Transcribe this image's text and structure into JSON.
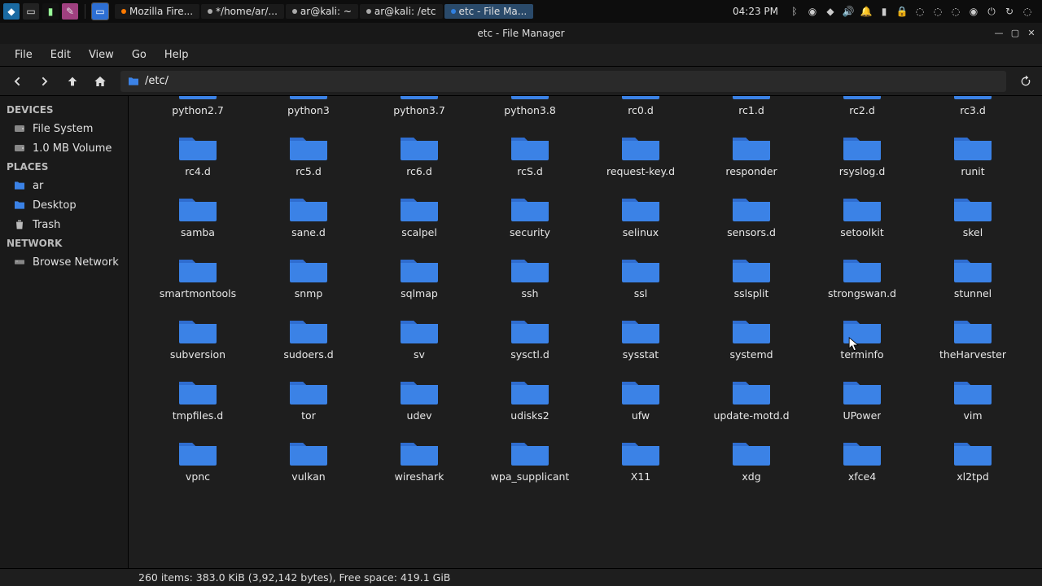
{
  "taskbar": {
    "time": "04:23 PM",
    "tasks": [
      {
        "label": "Mozilla Fire...",
        "kind": "ff"
      },
      {
        "label": "*/home/ar/...",
        "kind": "term"
      },
      {
        "label": "ar@kali: ~",
        "kind": "term"
      },
      {
        "label": "ar@kali: /etc",
        "kind": "term"
      },
      {
        "label": "etc - File Ma...",
        "kind": "fm",
        "active": true
      }
    ]
  },
  "window": {
    "title": "etc - File Manager"
  },
  "menubar": {
    "items": [
      "File",
      "Edit",
      "View",
      "Go",
      "Help"
    ]
  },
  "toolbar": {
    "path": "/etc/"
  },
  "sidebar": {
    "devices_header": "DEVICES",
    "devices": [
      {
        "label": "File System",
        "icon": "disk"
      },
      {
        "label": "1.0 MB Volume",
        "icon": "disk"
      }
    ],
    "places_header": "PLACES",
    "places": [
      {
        "label": "ar",
        "icon": "folder"
      },
      {
        "label": "Desktop",
        "icon": "folder"
      },
      {
        "label": "Trash",
        "icon": "trash"
      }
    ],
    "network_header": "NETWORK",
    "network": [
      {
        "label": "Browse Network",
        "icon": "net"
      }
    ]
  },
  "folders": {
    "row_partial": [
      "python2.7",
      "python3",
      "python3.7",
      "python3.8",
      "rc0.d",
      "rc1.d",
      "rc2.d",
      "rc3.d"
    ],
    "rows": [
      [
        "rc4.d",
        "rc5.d",
        "rc6.d",
        "rcS.d",
        "request-key.d",
        "responder",
        "rsyslog.d",
        "runit"
      ],
      [
        "samba",
        "sane.d",
        "scalpel",
        "security",
        "selinux",
        "sensors.d",
        "setoolkit",
        "skel"
      ],
      [
        "smartmontools",
        "snmp",
        "sqlmap",
        "ssh",
        "ssl",
        "sslsplit",
        "strongswan.d",
        "stunnel"
      ],
      [
        "subversion",
        "sudoers.d",
        "sv",
        "sysctl.d",
        "sysstat",
        "systemd",
        "terminfo",
        "theHarvester"
      ],
      [
        "tmpfiles.d",
        "tor",
        "udev",
        "udisks2",
        "ufw",
        "update-motd.d",
        "UPower",
        "vim"
      ],
      [
        "vpnc",
        "vulkan",
        "wireshark",
        "wpa_supplicant",
        "X11",
        "xdg",
        "xfce4",
        "xl2tpd"
      ]
    ]
  },
  "statusbar": {
    "text": "260 items: 383.0 KiB (3,92,142 bytes), Free space: 419.1 GiB"
  },
  "colors": {
    "folder": "#3b82e6",
    "accent": "#2d6fd4"
  }
}
